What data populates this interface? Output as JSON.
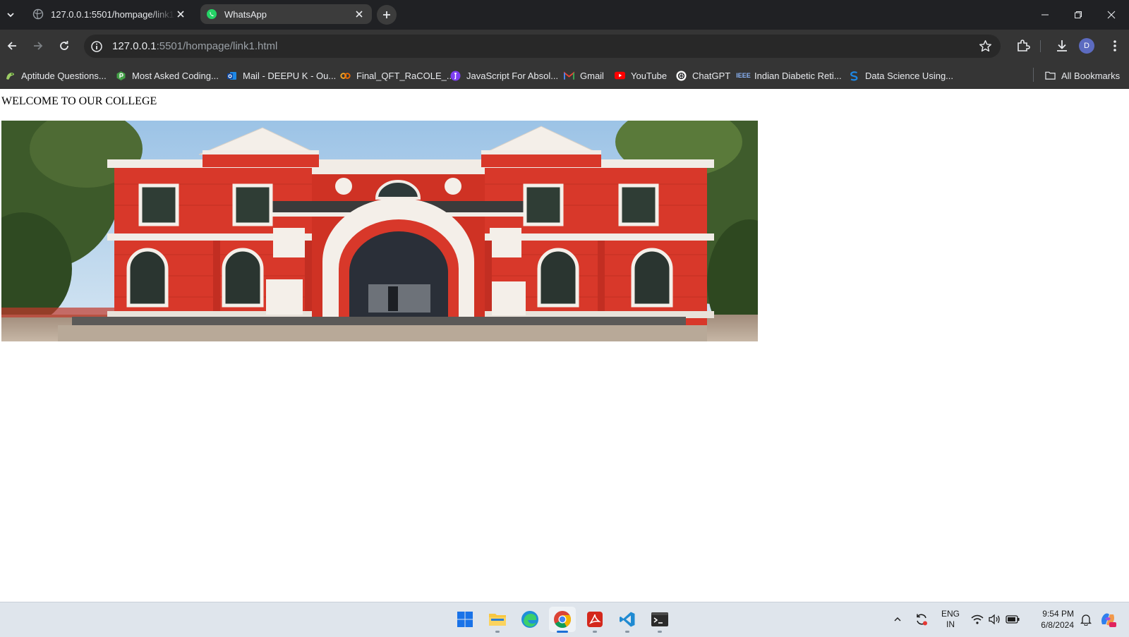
{
  "browser": {
    "tabs": [
      {
        "title": "127.0.0.1:5501/hompage/link1.html",
        "active": false
      },
      {
        "title": "WhatsApp",
        "active": true
      }
    ],
    "address": {
      "host": "127.0.0.1",
      "rest": ":5501/hompage/link1.html"
    },
    "profile_initial": "D",
    "bookmarks": [
      {
        "label": "Aptitude Questions...",
        "icon": "aptitude-icon"
      },
      {
        "label": "Most Asked Coding...",
        "icon": "coding-icon"
      },
      {
        "label": "Mail - DEEPU K - Ou...",
        "icon": "outlook-icon"
      },
      {
        "label": "Final_QFT_RaCOLE_...",
        "icon": "colab-icon"
      },
      {
        "label": "JavaScript For Absol...",
        "icon": "javascript-course-icon"
      },
      {
        "label": "Gmail",
        "icon": "gmail-icon"
      },
      {
        "label": "YouTube",
        "icon": "youtube-icon"
      },
      {
        "label": "ChatGPT",
        "icon": "chatgpt-icon"
      },
      {
        "label": "Indian Diabetic Reti...",
        "icon": "ieee-icon"
      },
      {
        "label": "Data Science Using...",
        "icon": "data-science-icon"
      }
    ],
    "all_bookmarks": "All Bookmarks"
  },
  "page": {
    "heading": "WELCOME TO OUR COLLEGE"
  },
  "taskbar": {
    "apps": [
      "windows-start-icon",
      "file-explorer-icon",
      "edge-icon",
      "chrome-icon",
      "acrobat-icon",
      "vscode-icon",
      "terminal-icon"
    ],
    "language": {
      "line1": "ENG",
      "line2": "IN"
    },
    "time": "9:54 PM",
    "date": "6/8/2024"
  },
  "colors": {
    "tab_strip": "#202124",
    "toolbar": "#353535",
    "building_red": "#d8382a",
    "taskbar": "#dfe5ec"
  }
}
